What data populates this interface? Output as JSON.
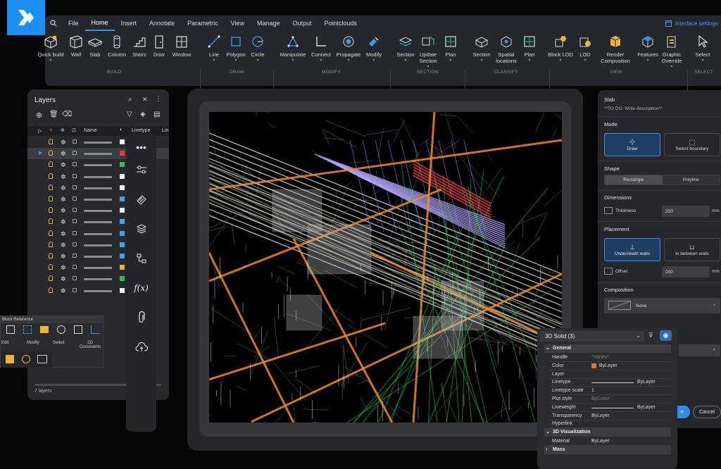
{
  "menu": {
    "items": [
      "File",
      "Home",
      "Insert",
      "Annotate",
      "Parametric",
      "View",
      "Manage",
      "Output",
      "Pointclouds"
    ],
    "active": "Home",
    "interface_settings": "Interface settings"
  },
  "ribbon": {
    "build": {
      "label": "BUILD",
      "tools": [
        "Quick build",
        "Wall",
        "Slab",
        "Column",
        "Stairs",
        "Door",
        "Window"
      ]
    },
    "draw": {
      "label": "DRAW",
      "tools": [
        "Line",
        "Polygon",
        "Circle"
      ]
    },
    "modify": {
      "label": "MODIFY",
      "tools": [
        "Manipulate",
        "Connect",
        "Propagate",
        "Modify"
      ]
    },
    "section": {
      "label": "SECTION",
      "tools": [
        "Section",
        "Update Section",
        "Plan"
      ]
    },
    "classify": {
      "label": "CLASSIFY",
      "tools": [
        "Section",
        "Spatial locations",
        "Plan"
      ]
    },
    "view": {
      "label": "VIEW",
      "tools": [
        "Block LOD",
        "LOD",
        "Render Composition",
        "Features",
        "Graphic Override"
      ]
    },
    "select": {
      "label": "SELECT",
      "tools": [
        "Select"
      ]
    }
  },
  "layers": {
    "title": "Layers",
    "col_name": "Name",
    "col_linetype": "Linetype",
    "col_lineweight": "Lin",
    "footer": "7 layers",
    "swatches": [
      "#f2f2f2",
      "#e23b3b",
      "#2fbf5a",
      "#f2f2f2",
      "#f2f2f2",
      "#3aa0e8",
      "#f2f2f2",
      "#3aa0e8",
      "#3aa0e8",
      "#3aa0e8",
      "#3aa0e8",
      "#e8b43a",
      "#2fbf5a",
      "#f2f2f2"
    ]
  },
  "block_reference": {
    "title": "Block Reference",
    "labels": [
      "Edit",
      "Modify",
      "Select",
      "2D Constraints"
    ]
  },
  "slab": {
    "title": "Slab",
    "description": "**TO DO: Write description**",
    "mode_label": "Mode",
    "mode_draw": "Draw",
    "mode_select": "Select boundary",
    "shape_label": "Shape",
    "shape_rect": "Rectangle",
    "shape_poly": "Polyline",
    "dimensions_label": "Dimensions",
    "thickness_label": "Thickness",
    "thickness_value": "200",
    "thickness_unit": "mm",
    "placement_label": "Placement",
    "underneath": "Underneath walls",
    "between": "In between walls",
    "offset_label": "Offset",
    "offset_value": "200",
    "offset_unit": "mm",
    "composition_label": "Composition",
    "composition_value": "None",
    "cancel": "Cancel",
    "ok": "e"
  },
  "properties": {
    "selector": "3D Solid (3)",
    "general": "General",
    "rows": [
      {
        "k": "Handle",
        "v": "*Varies*"
      },
      {
        "k": "Color",
        "v": "ByLayer"
      },
      {
        "k": "Layer",
        "v": ""
      },
      {
        "k": "Linetype",
        "v": "ByLayer"
      },
      {
        "k": "Linetype scale",
        "v": "1"
      },
      {
        "k": "Plot style",
        "v": "ByColor"
      },
      {
        "k": "Lineweight",
        "v": "ByLayer"
      },
      {
        "k": "Transparency",
        "v": "ByLayer"
      },
      {
        "k": "Hyperlink",
        "v": ""
      }
    ],
    "visualization": "3D Visualization",
    "material_k": "Material",
    "material_v": "ByLayer",
    "mass": "Mass"
  }
}
